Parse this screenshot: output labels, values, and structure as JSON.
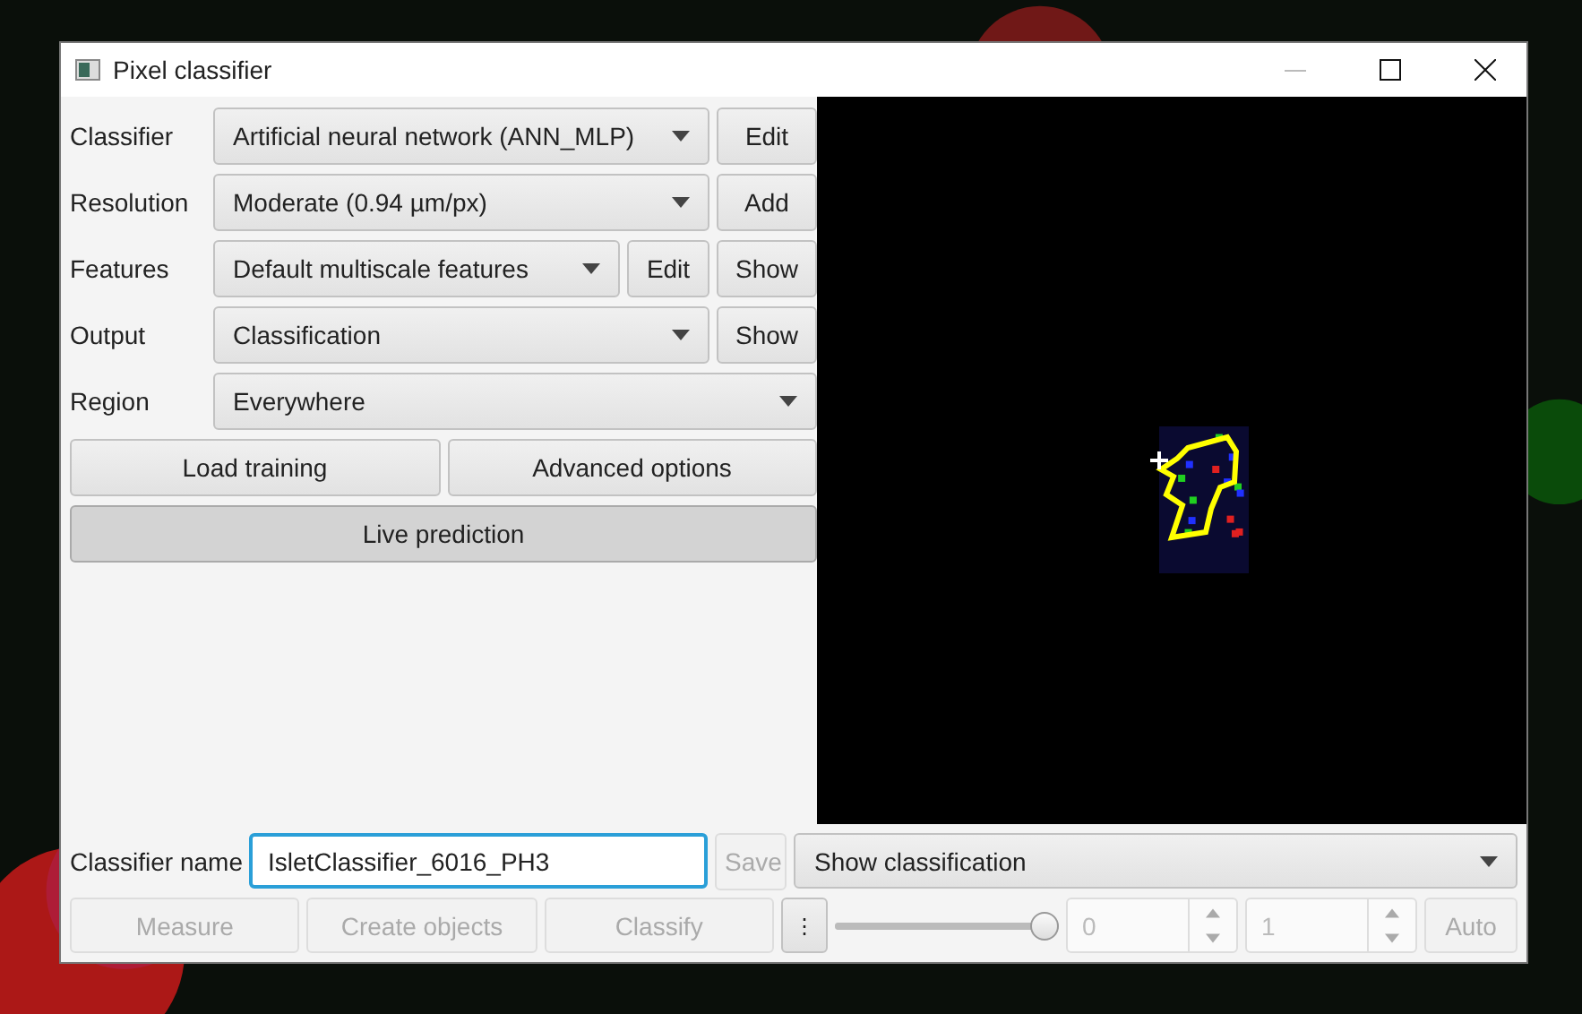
{
  "window": {
    "title": "Pixel classifier"
  },
  "settings": [
    {
      "label": "Classifier",
      "value": "Artificial neural network (ANN_MLP)",
      "buttons": [
        "Edit"
      ]
    },
    {
      "label": "Resolution",
      "value": "Moderate (0.94 µm/px)",
      "buttons": [
        "Add"
      ]
    },
    {
      "label": "Features",
      "value": "Default multiscale features",
      "buttons": [
        "Edit",
        "Show"
      ]
    },
    {
      "label": "Output",
      "value": "Classification",
      "buttons": [
        "Show"
      ]
    },
    {
      "label": "Region",
      "value": "Everywhere"
    }
  ],
  "actions": [
    "Load training",
    "Advanced options"
  ],
  "live_prediction": {
    "label": "Live prediction",
    "selected": true
  },
  "classifier_name": {
    "label": "Classifier name",
    "value": "IsletClassifier_6016_PH3"
  },
  "save_button": {
    "label": "Save",
    "disabled": true
  },
  "overlay_select": {
    "value": "Show classification"
  },
  "tools": [
    {
      "label": "Measure",
      "disabled": true
    },
    {
      "label": "Create objects",
      "disabled": true
    },
    {
      "label": "Classify",
      "disabled": true
    }
  ],
  "more_button": "⋮",
  "opacity_slider": {
    "level": 1.0
  },
  "spinners": [
    {
      "value": "0",
      "disabled": true
    },
    {
      "value": "1",
      "disabled": true
    }
  ],
  "auto_button": {
    "label": "Auto",
    "disabled": true
  }
}
